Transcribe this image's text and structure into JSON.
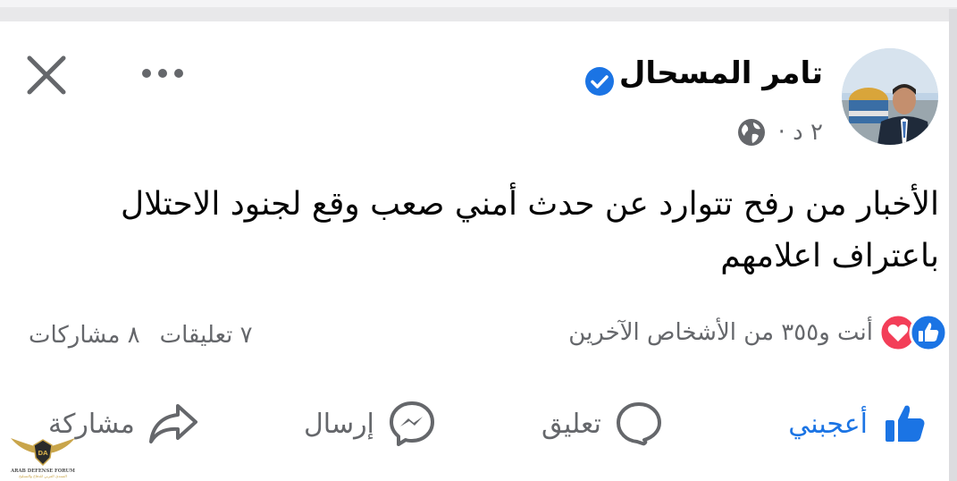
{
  "post": {
    "author": "تامر المسحال",
    "time": "٢ د ·",
    "text": "الأخبار من رفح تتوارد عن حدث أمني صعب وقع لجنود الاحتلال باعتراف اعلامهم"
  },
  "engagement": {
    "reactions_text": "أنت و٣٥٥ من الأشخاص الآخرين",
    "comments": "٧ تعليقات",
    "shares": "٨ مشاركات"
  },
  "actions": {
    "like": "أعجبني",
    "comment": "تعليق",
    "send": "إرسال",
    "share": "مشاركة"
  },
  "watermark": {
    "logo_text": "DA",
    "forum_name": "ARAB DEFENSE FORUM",
    "forum_name_ar": "المنتدى العربي للدفاع والتسليح"
  },
  "colors": {
    "like_blue": "#1b74e4",
    "love_red": "#f33e58",
    "secondary_text": "#65676b"
  },
  "icons": [
    "close-icon",
    "more-icon",
    "verified-icon",
    "globe-icon",
    "like-reaction-icon",
    "love-reaction-icon",
    "thumbs-up-icon",
    "comment-icon",
    "messenger-icon",
    "share-icon"
  ]
}
